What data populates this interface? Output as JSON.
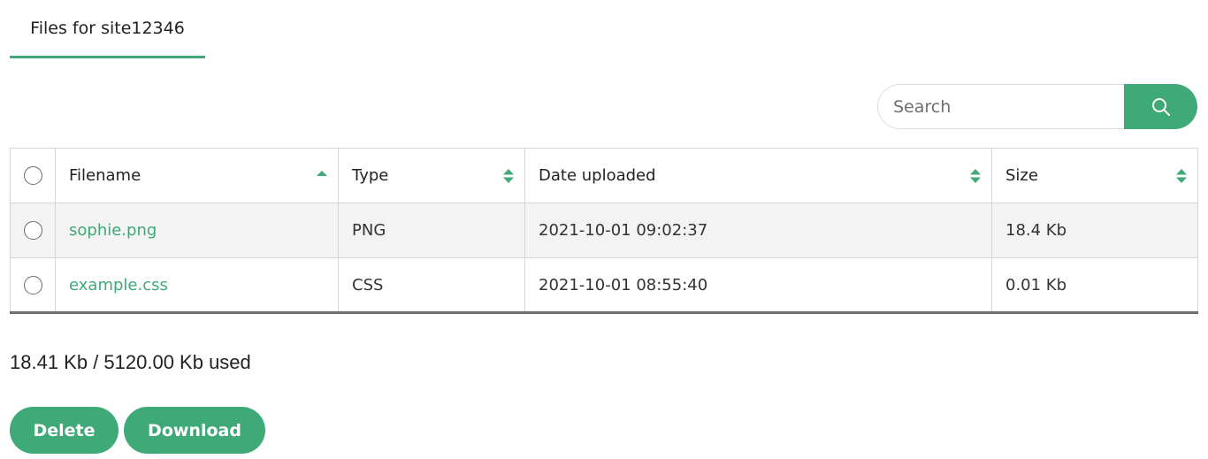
{
  "tab": {
    "label": "Files for site12346"
  },
  "search": {
    "placeholder": "Search",
    "value": "",
    "icon": "search-icon"
  },
  "table": {
    "columns": [
      {
        "label": "Filename",
        "sort": "asc"
      },
      {
        "label": "Type",
        "sort": "both"
      },
      {
        "label": "Date uploaded",
        "sort": "both"
      },
      {
        "label": "Size",
        "sort": "both"
      }
    ],
    "rows": [
      {
        "filename": "sophie.png",
        "type": "PNG",
        "date": "2021-10-01 09:02:37",
        "size": "18.4 Kb"
      },
      {
        "filename": "example.css",
        "type": "CSS",
        "date": "2021-10-01 08:55:40",
        "size": "0.01 Kb"
      }
    ]
  },
  "usage": {
    "text": "18.41 Kb / 5120.00 Kb used"
  },
  "actions": {
    "delete_label": "Delete",
    "download_label": "Download"
  },
  "colors": {
    "accent": "#3fa978",
    "row_alt": "#f3f3f3",
    "border": "#d6d6d6"
  }
}
